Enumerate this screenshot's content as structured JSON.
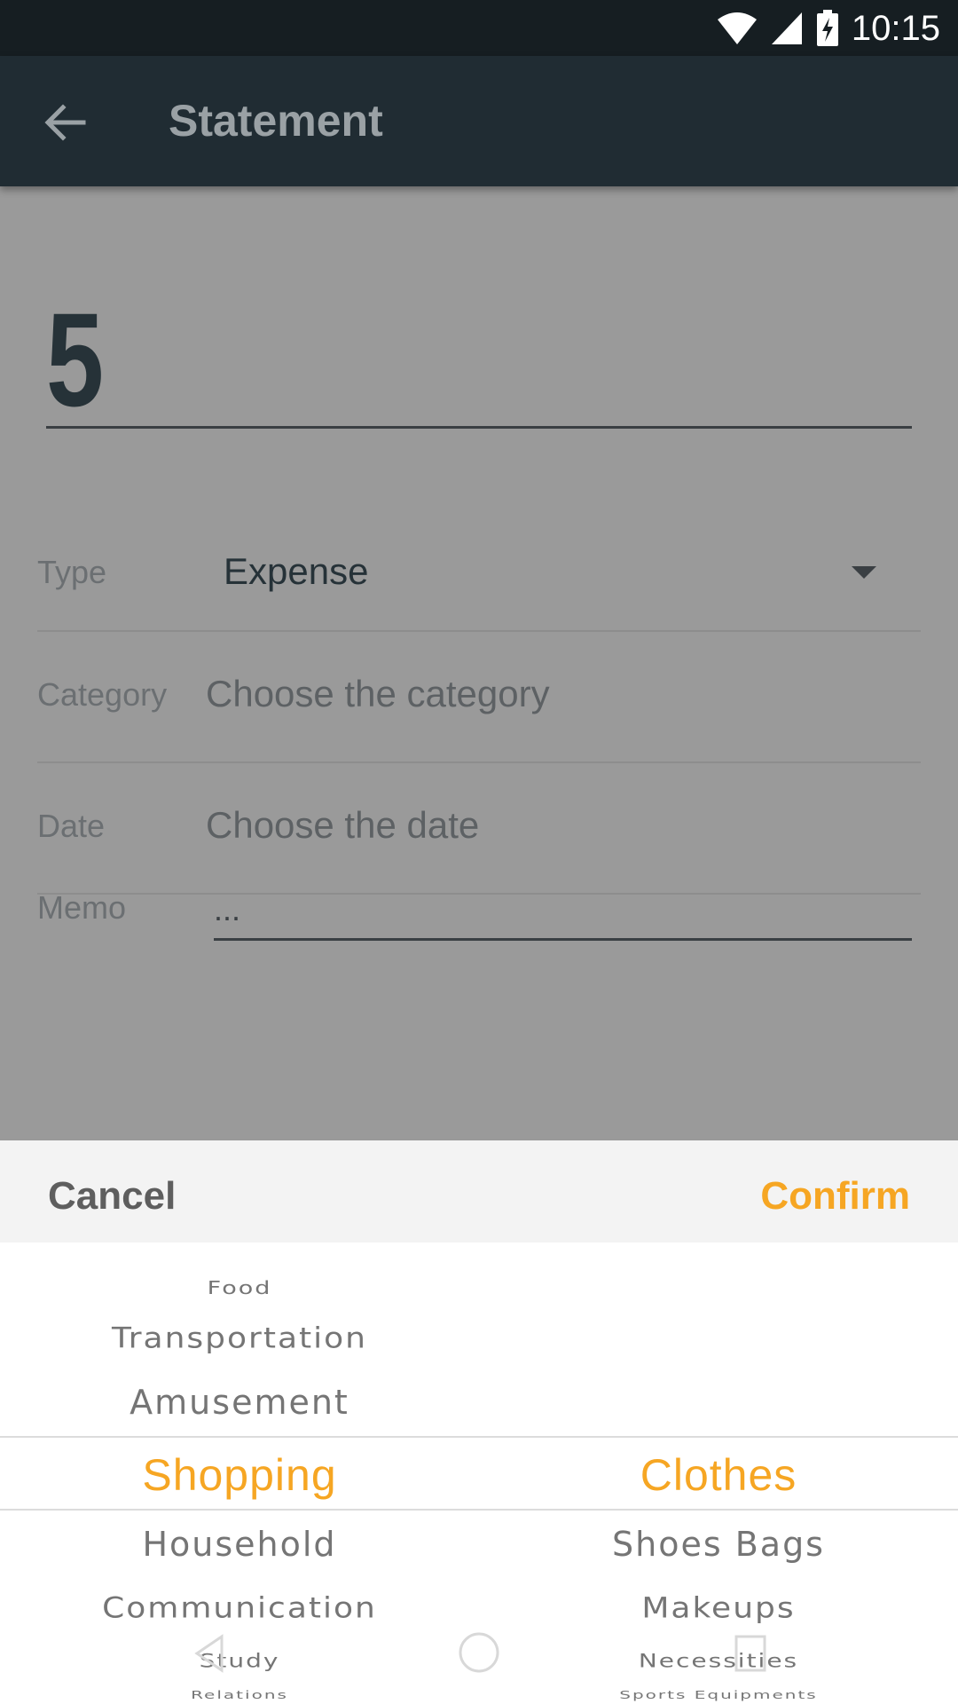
{
  "status_bar": {
    "time": "10:15"
  },
  "app_bar": {
    "title": "Statement"
  },
  "form": {
    "amount": "5",
    "type": {
      "label": "Type",
      "value": "Expense"
    },
    "category": {
      "label": "Category",
      "placeholder": "Choose the category"
    },
    "date": {
      "label": "Date",
      "placeholder": "Choose the date"
    },
    "memo": {
      "label": "Memo",
      "value": "..."
    }
  },
  "sheet": {
    "cancel_label": "Cancel",
    "confirm_label": "Confirm",
    "accent_color": "#f6a623",
    "left_column": {
      "items": [
        "Food",
        "Transportation",
        "Amusement",
        "Shopping",
        "Household",
        "Communication",
        "Study",
        "Relations"
      ],
      "selected": "Shopping"
    },
    "right_column": {
      "items": [
        "Clothes",
        "Shoes Bags",
        "Makeups",
        "Necessities",
        "Sports Equipments"
      ],
      "selected": "Clothes"
    }
  }
}
